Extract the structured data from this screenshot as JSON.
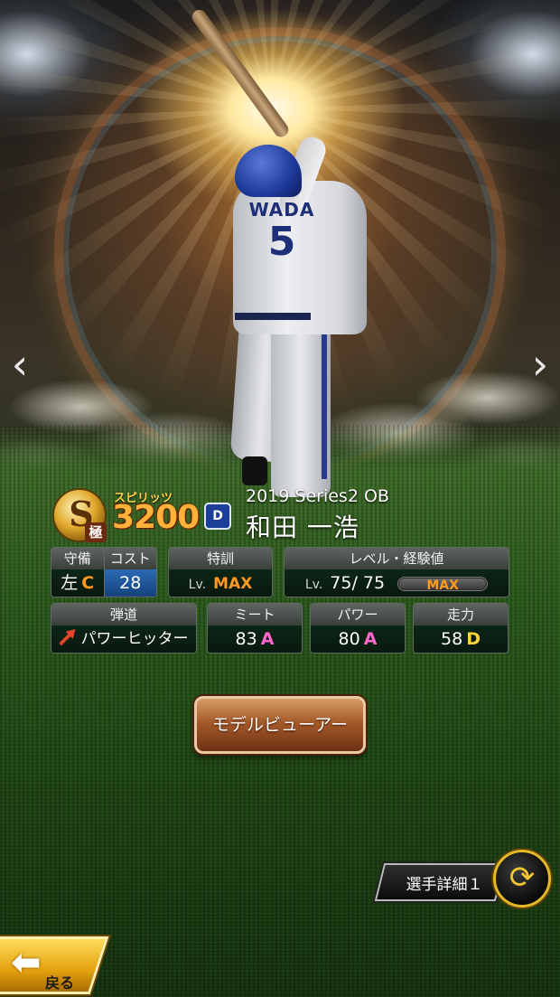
{
  "card": {
    "series": "2019 Series2 OB",
    "player_name": "和田 一浩",
    "rank": "S",
    "rank_modifier": "極",
    "spirits_label": "スピリッツ",
    "spirits_value": "3200",
    "team_logo": "D",
    "jersey_name": "WADA",
    "jersey_number": "5"
  },
  "stats": {
    "position": {
      "header": "守備",
      "value": "左",
      "grade": "C",
      "grade_color": "#ff9a1e"
    },
    "cost": {
      "header": "コスト",
      "value": "28"
    },
    "training": {
      "header": "特訓",
      "lv_prefix": "Lv.",
      "value": "MAX"
    },
    "level": {
      "header": "レベル・経験値",
      "lv_prefix": "Lv.",
      "value": "75/ 75",
      "bar_label": "MAX",
      "exp_fraction": 1.0
    },
    "trajectory": {
      "header": "弾道",
      "value": "パワーヒッター"
    },
    "meet": {
      "header": "ミート",
      "value": "83",
      "grade": "A",
      "grade_color": "#ff66cc"
    },
    "power": {
      "header": "パワー",
      "value": "80",
      "grade": "A",
      "grade_color": "#ff66cc"
    },
    "speed": {
      "header": "走力",
      "value": "58",
      "grade": "D",
      "grade_color": "#ffd23a"
    }
  },
  "buttons": {
    "model_viewer": "モデルビューアー",
    "player_detail": "選手詳細１",
    "back": "戻る"
  },
  "icons": {
    "prev": "chevron-left-icon",
    "next": "chevron-right-icon",
    "cycle": "cycle-arrows-icon",
    "back": "arrow-left-icon"
  }
}
